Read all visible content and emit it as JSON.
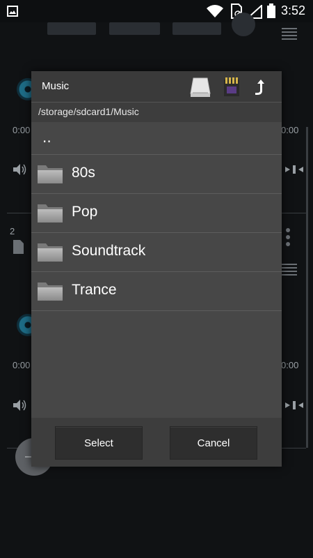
{
  "statusbar": {
    "time": "3:52"
  },
  "background": {
    "time_left_1": "0:00",
    "time_right_1": "0:00",
    "track_number": "2",
    "time_left_2": "0:00",
    "time_right_2": "0:00"
  },
  "dialog": {
    "title": "Music",
    "path": "/storage/sdcard1/Music",
    "parent_label": "..",
    "folders": [
      "80s",
      "Pop",
      "Soundtrack",
      "Trance"
    ],
    "select_label": "Select",
    "cancel_label": "Cancel"
  }
}
